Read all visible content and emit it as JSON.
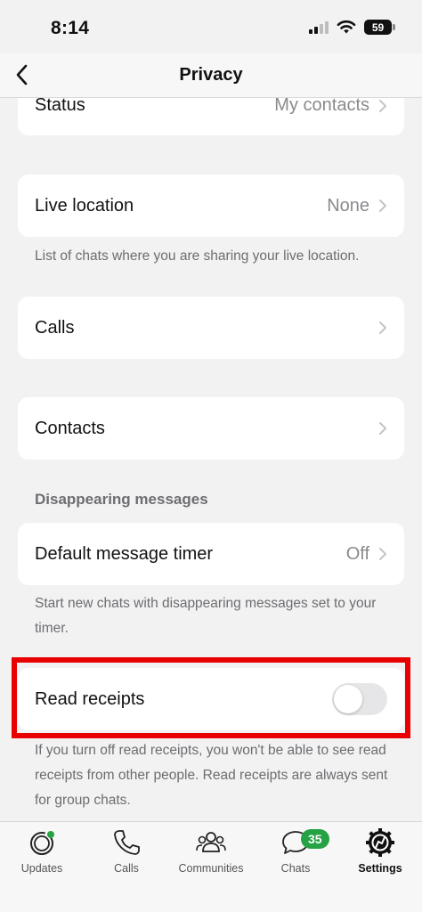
{
  "status_bar": {
    "time": "8:14",
    "battery": "59"
  },
  "header": {
    "title": "Privacy"
  },
  "rows": {
    "status": {
      "label": "Status",
      "value": "My contacts"
    },
    "live_location": {
      "label": "Live location",
      "value": "None",
      "note": "List of chats where you are sharing your live location."
    },
    "calls": {
      "label": "Calls"
    },
    "contacts": {
      "label": "Contacts"
    },
    "disappearing": {
      "section_title": "Disappearing messages",
      "label": "Default message timer",
      "value": "Off",
      "note": "Start new chats with disappearing messages set to your timer."
    },
    "read_receipts": {
      "label": "Read receipts",
      "enabled": false,
      "note": "If you turn off read receipts, you won't be able to see read receipts from other people. Read receipts are always sent for group chats."
    }
  },
  "tab_bar": {
    "tabs": [
      {
        "label": "Updates",
        "icon": "updates-icon"
      },
      {
        "label": "Calls",
        "icon": "phone-icon"
      },
      {
        "label": "Communities",
        "icon": "communities-icon"
      },
      {
        "label": "Chats",
        "icon": "chats-icon",
        "badge": "35"
      },
      {
        "label": "Settings",
        "icon": "settings-icon",
        "active": true
      }
    ]
  },
  "colors": {
    "accent_badge": "#25a244",
    "highlight_border": "#e90000",
    "background": "#f2f2f2"
  }
}
